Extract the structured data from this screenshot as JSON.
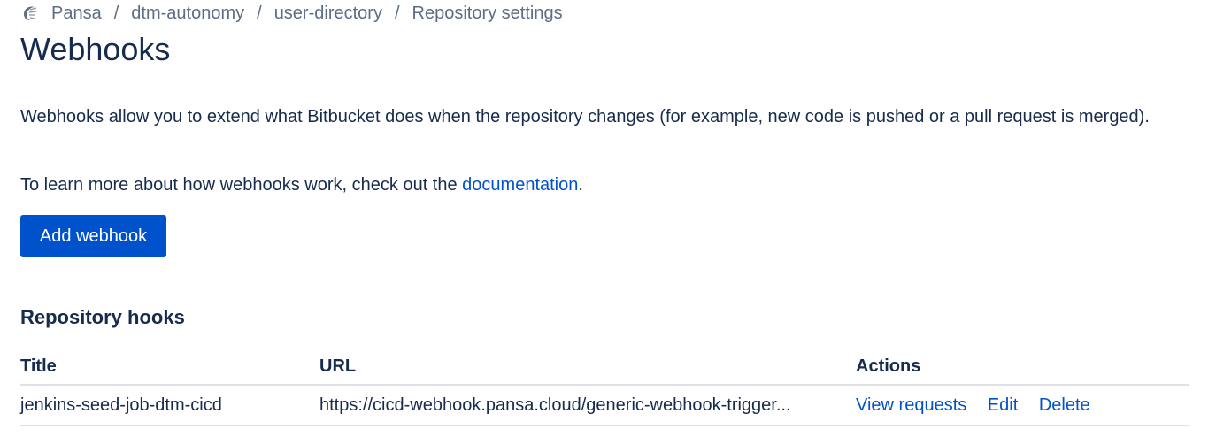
{
  "breadcrumb": {
    "workspace_icon": "workspace-logo-icon",
    "workspace": "Pansa",
    "project": "dtm-autonomy",
    "repository": "user-directory",
    "page": "Repository settings",
    "separator": "/"
  },
  "header": {
    "title": "Webhooks"
  },
  "intro": {
    "description": "Webhooks allow you to extend what Bitbucket does when the repository changes (for example, new code is pushed or a pull request is merged).",
    "learn_more_prefix": "To learn more about how webhooks work, check out the ",
    "learn_more_link": "documentation",
    "learn_more_suffix": "."
  },
  "actions": {
    "add_webhook_label": "Add webhook"
  },
  "colors": {
    "primary": "#0052cc",
    "text": "#172b4d",
    "subtle": "#5e6c84",
    "border": "#dfe1e6"
  },
  "repository_hooks": {
    "heading": "Repository hooks",
    "columns": {
      "title": "Title",
      "url": "URL",
      "actions": "Actions"
    },
    "rows": [
      {
        "title": "jenkins-seed-job-dtm-cicd",
        "url": "https://cicd-webhook.pansa.cloud/generic-webhook-trigger...",
        "view_requests": "View requests",
        "edit": "Edit",
        "delete": "Delete"
      }
    ]
  }
}
